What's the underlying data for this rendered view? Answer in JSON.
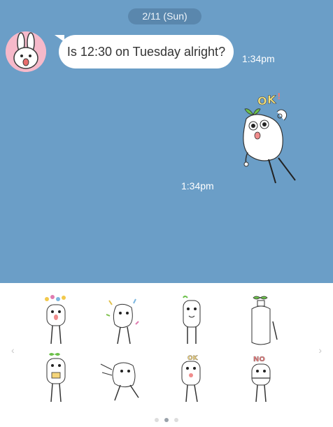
{
  "chat": {
    "background_color": "#6b9ec7",
    "date_label": "2/11 (Sun)",
    "messages": [
      {
        "text": "Is 12:30 on Tuesday alright?",
        "time": "1:34pm"
      },
      {
        "sticker": "ok-sticker",
        "time": "1:34pm"
      }
    ]
  },
  "sticker_panel": {
    "stickers": [
      "sticker-happy-flowers",
      "sticker-confetti",
      "sticker-sweat",
      "sticker-bottle",
      "sticker-hug",
      "sticker-dash",
      "sticker-ok",
      "sticker-no"
    ],
    "page_count": 3,
    "current_page": 2
  }
}
